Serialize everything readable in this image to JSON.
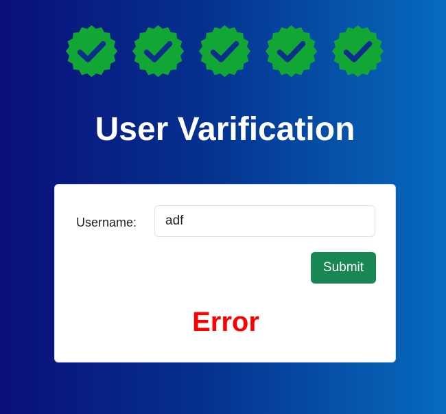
{
  "badges": [
    {
      "icon": "verified-check-badge-icon",
      "color": "#12a634"
    },
    {
      "icon": "verified-check-badge-icon",
      "color": "#12a634"
    },
    {
      "icon": "verified-check-badge-icon",
      "color": "#12a634"
    },
    {
      "icon": "verified-check-badge-icon",
      "color": "#12a634"
    },
    {
      "icon": "verified-check-badge-icon",
      "color": "#12a634"
    }
  ],
  "header": {
    "title": "User Varification"
  },
  "form": {
    "username_label": "Username:",
    "username_value": "adf",
    "submit_label": "Submit",
    "status_message": "Error"
  },
  "colors": {
    "badge_fill": "#12a634",
    "checkmark": "#0b2f8a",
    "submit_button": "#198754",
    "error_text": "#ff0000"
  }
}
